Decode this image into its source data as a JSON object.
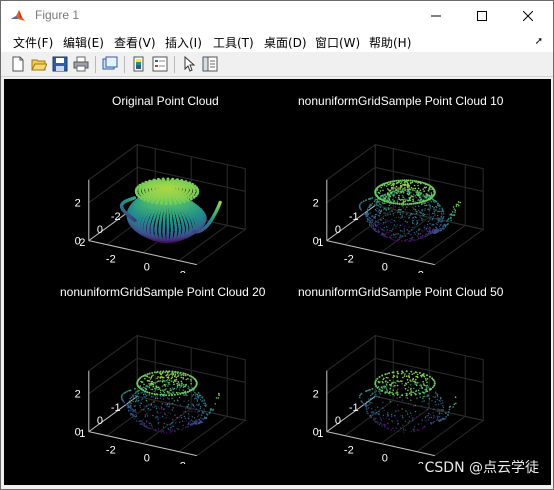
{
  "window": {
    "title": "Figure 1",
    "accent": "#f0f0f0"
  },
  "menu": {
    "items": [
      "文件(F)",
      "编辑(E)",
      "查看(V)",
      "插入(I)",
      "工具(T)",
      "桌面(D)",
      "窗口(W)",
      "帮助(H)"
    ]
  },
  "toolbar": {
    "icons": [
      "new-figure-icon",
      "open-file-icon",
      "save-icon",
      "print-icon",
      "link-plot-icon",
      "insert-colorbar-icon",
      "insert-legend-icon",
      "edit-plot-icon",
      "property-inspector-icon"
    ]
  },
  "plots": [
    {
      "title": "Original Point Cloud",
      "ticks_z": [
        "2",
        "0"
      ],
      "ticks_y": [
        "2",
        "0",
        "-2"
      ],
      "ticks_x": [
        "-2",
        "0",
        "2"
      ]
    },
    {
      "title": "nonuniformGridSample Point Cloud 10",
      "ticks_z": [
        "2",
        "0"
      ],
      "ticks_y": [
        "1",
        "0",
        "-1"
      ],
      "ticks_x": [
        "-2",
        "0",
        "2"
      ]
    },
    {
      "title": "nonuniformGridSample Point Cloud 20",
      "ticks_z": [
        "2",
        "0"
      ],
      "ticks_y": [
        "1",
        "0",
        "-1"
      ],
      "ticks_x": [
        "-2",
        "0",
        "2"
      ]
    },
    {
      "title": "nonuniformGridSample Point Cloud 50",
      "ticks_z": [
        "2",
        "0"
      ],
      "ticks_y": [
        "1",
        "0",
        "-1"
      ],
      "ticks_x": [
        "-2",
        "0",
        "2"
      ]
    }
  ],
  "watermark": "CSDN @点云学徒",
  "colors": {
    "figure_bg": "#000000",
    "colormap": [
      "#440154",
      "#3b528b",
      "#21918c",
      "#5ec962",
      "#fde725"
    ]
  }
}
